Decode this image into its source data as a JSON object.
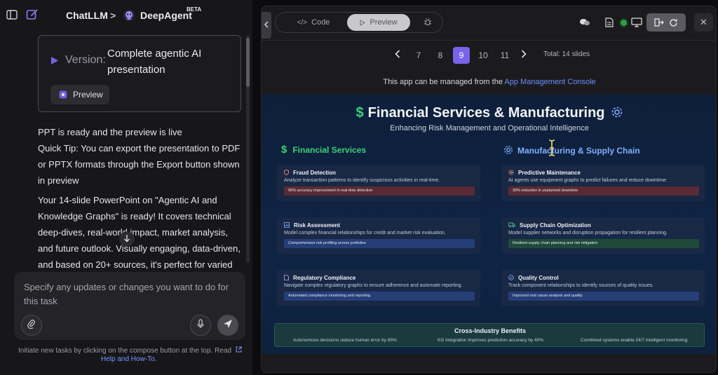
{
  "header": {
    "app_name": "ChatLLM",
    "separator": ">",
    "agent_name": "DeepAgent",
    "agent_badge": "BETA"
  },
  "chat": {
    "version_label": "Version:",
    "version_value": "Complete agentic AI presentation",
    "preview_label": "Preview",
    "messages": [
      "PPT is ready and the preview is live",
      "Quick Tip: You can export the presentation to PDF or PPTX formats through the Export button shown in preview",
      "Your 14-slide PowerPoint on \"Agentic AI and Knowledge Graphs\" is ready! It covers technical deep-dives, real-world impact, market analysis, and future outlook. Visually engaging, data-driven, and based on 20+ sources, it's perfect for varied"
    ]
  },
  "composer": {
    "placeholder": "Specify any updates or changes you want to do for this task"
  },
  "hint": {
    "text": "Initiate new tasks by clicking on the compose button at the top. Read",
    "link": "Help and How-To."
  },
  "preview_panel": {
    "tabs": {
      "code": "Code",
      "preview": "Preview"
    },
    "pager": {
      "pages": [
        "7",
        "8",
        "9",
        "10",
        "11"
      ],
      "current": "9",
      "total": "Total: 14 slides"
    },
    "managed_text": "This app can be managed from the",
    "managed_link": "App Management Console"
  },
  "slide": {
    "title": "Financial Services & Manufacturing",
    "subtitle": "Enhancing Risk Management and Operational Intelligence",
    "left_heading": "Financial Services",
    "right_heading": "Manufacturing & Supply Chain",
    "left_cards": [
      {
        "title": "Fraud Detection",
        "desc": "Analyze transaction patterns to identify suspicious activities in real-time.",
        "bar": "90% accuracy improvement in real-time detection"
      },
      {
        "title": "Risk Assessment",
        "desc": "Model complex financial relationships for credit and market risk evaluation.",
        "bar": "Comprehensive risk profiling across portfolios"
      },
      {
        "title": "Regulatory Compliance",
        "desc": "Navigate complex regulatory graphs to ensure adherence and automate reporting.",
        "bar": "Automated compliance monitoring and reporting"
      }
    ],
    "right_cards": [
      {
        "title": "Predictive Maintenance",
        "desc": "AI agents use equipment graphs to predict failures and reduce downtime.",
        "bar": "30% reduction in unplanned downtime"
      },
      {
        "title": "Supply Chain Optimization",
        "desc": "Model supplier networks and disruption propagation for resilient planning.",
        "bar": "Resilient supply chain planning and risk mitigation"
      },
      {
        "title": "Quality Control",
        "desc": "Track component relationships to identify sources of quality issues.",
        "bar": "Improved root cause analysis and quality"
      }
    ],
    "benefits_title": "Cross-Industry Benefits",
    "benefits": [
      "Autonomous decisions reduce human error by 65%",
      "KG integration improves prediction accuracy by 40%",
      "Combined systems enable 24/7 intelligent monitoring"
    ]
  },
  "colors": {
    "accent": "#7a63e8",
    "link": "#6f8cff",
    "green": "#3fd07a",
    "slide_bg": "#0f2444"
  }
}
